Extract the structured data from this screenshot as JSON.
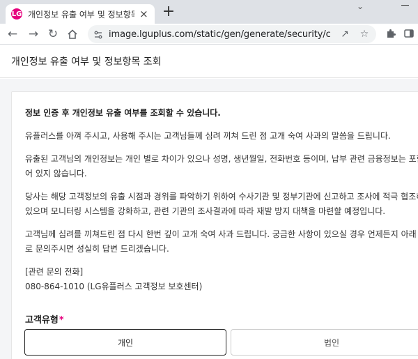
{
  "browser": {
    "tab_title": "개인정보 유출 여부 및 정보항목",
    "tab_favicon_text": "LG",
    "new_tab_symbol": "+",
    "close_symbol": "×",
    "url": "image.lguplus.com/static/gen/generate/security/check..."
  },
  "page": {
    "title": "개인정보 유출 여부 및 정보항목 조회"
  },
  "notice": {
    "intro": "정보 인증 후 개인정보 유출 여부를 조회할 수 있습니다.",
    "apology": "유플러스를 아껴 주시고, 사용해 주시는 고객님들께 심려 끼쳐 드린 점 고개 숙여 사과의 말씀을 드립니다.",
    "detail_line1": "유출된 고객님의 개인정보는 개인 별로 차이가 있으나 성명, 생년월일, 전화번호 등이며, 납부 관련 금융정보는 포함",
    "detail_line2": "어 있지 않습니다.",
    "measures_line1": "당사는 해당 고객정보의 유출 시점과 경위를 파악하기 위하여 수사기관 및 정부기관에 신고하고 조사에 적극 협조하",
    "measures_line2": "있으며 모니터링 시스템을 강화하고, 관련 기관의 조사결과에 따라 재발 방지 대책을 마련할 예정입니다.",
    "closing_line1": "고객님께 심려를 끼쳐드린 점 다시 한번 깊이 고개 숙여 사과 드립니다. 궁금한 사항이 있으실 경우 언제든지 아래 번",
    "closing_line2": "로 문의주시면 성실히 답변 드리겠습니다.",
    "contact_label": "[관련 문의 전화]",
    "contact_number": "080-864-1010 (LG유플러스 고객정보 보호센터)"
  },
  "form": {
    "customer_type_label": "고객유형",
    "required_mark": "*",
    "options": [
      "개인",
      "법인"
    ],
    "selected": "개인"
  }
}
